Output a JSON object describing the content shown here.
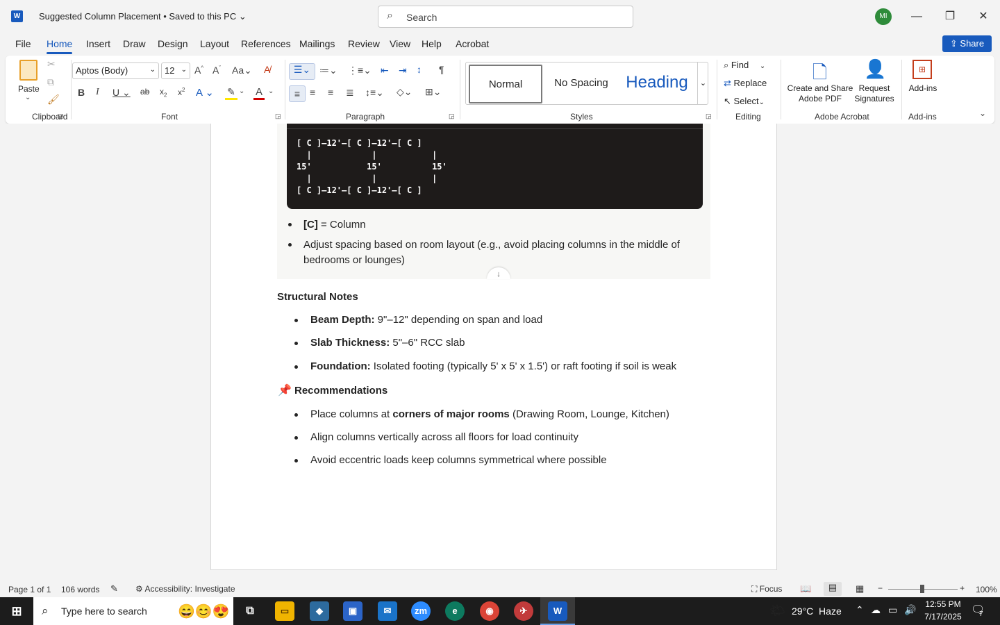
{
  "titlebar": {
    "app_logo": "W",
    "doc_title": "Suggested Column Placement • Saved to this PC",
    "search_placeholder": "Search",
    "avatar": "MI"
  },
  "tabs": [
    "File",
    "Home",
    "Insert",
    "Draw",
    "Design",
    "Layout",
    "References",
    "Mailings",
    "Review",
    "View",
    "Help",
    "Acrobat"
  ],
  "share_label": "Share",
  "ribbon": {
    "paste": "Paste",
    "font_name": "Aptos (Body)",
    "font_size": "12",
    "groups": {
      "clipboard": "Clipboard",
      "font": "Font",
      "paragraph": "Paragraph",
      "styles": "Styles",
      "editing": "Editing",
      "adobe": "Adobe Acrobat",
      "addins": "Add-ins"
    },
    "styles": [
      "Normal",
      "No Spacing",
      "Heading"
    ],
    "find": "Find",
    "replace": "Replace",
    "select": "Select",
    "create_share": "Create and Share",
    "adobe_pdf": "Adobe PDF",
    "request": "Request",
    "signatures": "Signatures",
    "addins_btn": "Add-ins"
  },
  "document": {
    "code_block": "[ C ]—12'—[ C ]—12'—[ C ]\n  |            |           |\n15'           15'          15'\n  |            |           |\n[ C ]—12'—[ C ]—12'—[ C ]",
    "legend_bold": "[C]",
    "legend_rest": " = Column",
    "adjust_line1": "Adjust spacing based on room layout (e.g., avoid placing columns in the middle of",
    "adjust_line2": "bedrooms or lounges)",
    "structural_heading": "Structural Notes",
    "beam_bold": "Beam Depth:",
    "beam_rest": " 9\"–12\" depending on span and load",
    "slab_bold": "Slab Thickness:",
    "slab_rest": " 5\"–6\" RCC slab",
    "foundation_bold": "Foundation:",
    "foundation_rest": " Isolated footing (typically 5' x 5' x 1.5') or raft footing if soil is weak",
    "rec_heading": "Recommendations",
    "rec1_a": "Place columns at ",
    "rec1_bold": "corners of major rooms",
    "rec1_c": " (Drawing Room, Lounge, Kitchen)",
    "rec2": "Align columns vertically across all floors for load continuity",
    "rec3": "Avoid eccentric loads keep columns symmetrical where possible"
  },
  "statusbar": {
    "page": "Page 1 of 1",
    "words": "106 words",
    "accessibility": "Accessibility: Investigate",
    "focus": "Focus",
    "zoom": "100%"
  },
  "taskbar": {
    "search_placeholder": "Type here to search",
    "weather": "29°C  Haze",
    "time": "12:55 PM",
    "date": "7/17/2025",
    "notif_count": "7"
  },
  "colors": {
    "accent": "#185abd",
    "code_bg": "#1e1b1a"
  }
}
